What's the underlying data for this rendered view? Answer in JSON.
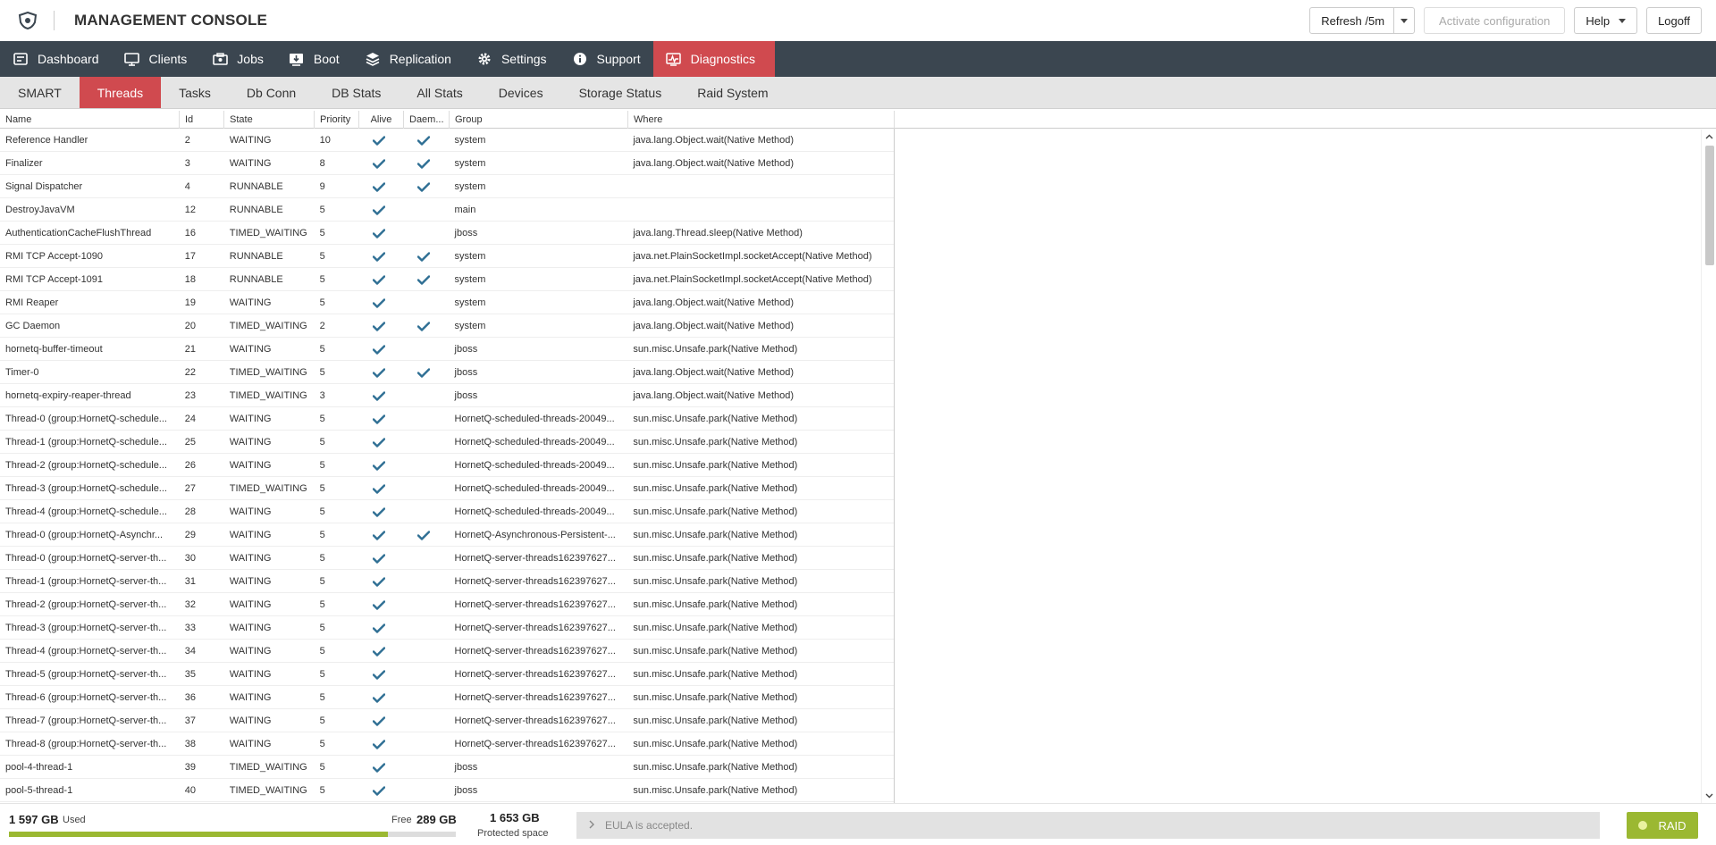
{
  "header": {
    "title": "MANAGEMENT CONSOLE",
    "refresh_label": "Refresh /5m",
    "activate_label": "Activate configuration",
    "help_label": "Help",
    "logoff_label": "Logoff"
  },
  "nav": {
    "items": [
      {
        "label": "Dashboard",
        "icon": "dashboard-icon"
      },
      {
        "label": "Clients",
        "icon": "monitor-icon"
      },
      {
        "label": "Jobs",
        "icon": "jobs-icon"
      },
      {
        "label": "Boot",
        "icon": "boot-icon"
      },
      {
        "label": "Replication",
        "icon": "replication-icon"
      },
      {
        "label": "Settings",
        "icon": "gear-icon"
      },
      {
        "label": "Support",
        "icon": "info-icon"
      },
      {
        "label": "Diagnostics",
        "icon": "diagnostics-icon"
      }
    ],
    "active": "Diagnostics"
  },
  "subnav": {
    "items": [
      "SMART",
      "Threads",
      "Tasks",
      "Db Conn",
      "DB Stats",
      "All Stats",
      "Devices",
      "Storage Status",
      "Raid System"
    ],
    "active": "Threads"
  },
  "table": {
    "columns": [
      "Name",
      "Id",
      "State",
      "Priority",
      "Alive",
      "Daem...",
      "Group",
      "Where"
    ],
    "rows": [
      {
        "name": "Reference Handler",
        "id": "2",
        "state": "WAITING",
        "priority": "10",
        "alive": true,
        "daemon": true,
        "group": "system",
        "where": "java.lang.Object.wait(Native Method)"
      },
      {
        "name": "Finalizer",
        "id": "3",
        "state": "WAITING",
        "priority": "8",
        "alive": true,
        "daemon": true,
        "group": "system",
        "where": "java.lang.Object.wait(Native Method)"
      },
      {
        "name": "Signal Dispatcher",
        "id": "4",
        "state": "RUNNABLE",
        "priority": "9",
        "alive": true,
        "daemon": true,
        "group": "system",
        "where": ""
      },
      {
        "name": "DestroyJavaVM",
        "id": "12",
        "state": "RUNNABLE",
        "priority": "5",
        "alive": true,
        "daemon": false,
        "group": "main",
        "where": ""
      },
      {
        "name": "AuthenticationCacheFlushThread",
        "id": "16",
        "state": "TIMED_WAITING",
        "priority": "5",
        "alive": true,
        "daemon": false,
        "group": "jboss",
        "where": "java.lang.Thread.sleep(Native Method)"
      },
      {
        "name": "RMI TCP Accept-1090",
        "id": "17",
        "state": "RUNNABLE",
        "priority": "5",
        "alive": true,
        "daemon": true,
        "group": "system",
        "where": "java.net.PlainSocketImpl.socketAccept(Native Method)"
      },
      {
        "name": "RMI TCP Accept-1091",
        "id": "18",
        "state": "RUNNABLE",
        "priority": "5",
        "alive": true,
        "daemon": true,
        "group": "system",
        "where": "java.net.PlainSocketImpl.socketAccept(Native Method)"
      },
      {
        "name": "RMI Reaper",
        "id": "19",
        "state": "WAITING",
        "priority": "5",
        "alive": true,
        "daemon": false,
        "group": "system",
        "where": "java.lang.Object.wait(Native Method)"
      },
      {
        "name": "GC Daemon",
        "id": "20",
        "state": "TIMED_WAITING",
        "priority": "2",
        "alive": true,
        "daemon": true,
        "group": "system",
        "where": "java.lang.Object.wait(Native Method)"
      },
      {
        "name": "hornetq-buffer-timeout",
        "id": "21",
        "state": "WAITING",
        "priority": "5",
        "alive": true,
        "daemon": false,
        "group": "jboss",
        "where": "sun.misc.Unsafe.park(Native Method)"
      },
      {
        "name": "Timer-0",
        "id": "22",
        "state": "TIMED_WAITING",
        "priority": "5",
        "alive": true,
        "daemon": true,
        "group": "jboss",
        "where": "java.lang.Object.wait(Native Method)"
      },
      {
        "name": "hornetq-expiry-reaper-thread",
        "id": "23",
        "state": "TIMED_WAITING",
        "priority": "3",
        "alive": true,
        "daemon": false,
        "group": "jboss",
        "where": "java.lang.Object.wait(Native Method)"
      },
      {
        "name": "Thread-0 (group:HornetQ-schedule...",
        "id": "24",
        "state": "WAITING",
        "priority": "5",
        "alive": true,
        "daemon": false,
        "group": "HornetQ-scheduled-threads-20049...",
        "where": "sun.misc.Unsafe.park(Native Method)"
      },
      {
        "name": "Thread-1 (group:HornetQ-schedule...",
        "id": "25",
        "state": "WAITING",
        "priority": "5",
        "alive": true,
        "daemon": false,
        "group": "HornetQ-scheduled-threads-20049...",
        "where": "sun.misc.Unsafe.park(Native Method)"
      },
      {
        "name": "Thread-2 (group:HornetQ-schedule...",
        "id": "26",
        "state": "WAITING",
        "priority": "5",
        "alive": true,
        "daemon": false,
        "group": "HornetQ-scheduled-threads-20049...",
        "where": "sun.misc.Unsafe.park(Native Method)"
      },
      {
        "name": "Thread-3 (group:HornetQ-schedule...",
        "id": "27",
        "state": "TIMED_WAITING",
        "priority": "5",
        "alive": true,
        "daemon": false,
        "group": "HornetQ-scheduled-threads-20049...",
        "where": "sun.misc.Unsafe.park(Native Method)"
      },
      {
        "name": "Thread-4 (group:HornetQ-schedule...",
        "id": "28",
        "state": "WAITING",
        "priority": "5",
        "alive": true,
        "daemon": false,
        "group": "HornetQ-scheduled-threads-20049...",
        "where": "sun.misc.Unsafe.park(Native Method)"
      },
      {
        "name": "Thread-0 (group:HornetQ-Asynchr...",
        "id": "29",
        "state": "WAITING",
        "priority": "5",
        "alive": true,
        "daemon": true,
        "group": "HornetQ-Asynchronous-Persistent-...",
        "where": "sun.misc.Unsafe.park(Native Method)"
      },
      {
        "name": "Thread-0 (group:HornetQ-server-th...",
        "id": "30",
        "state": "WAITING",
        "priority": "5",
        "alive": true,
        "daemon": false,
        "group": "HornetQ-server-threads162397627...",
        "where": "sun.misc.Unsafe.park(Native Method)"
      },
      {
        "name": "Thread-1 (group:HornetQ-server-th...",
        "id": "31",
        "state": "WAITING",
        "priority": "5",
        "alive": true,
        "daemon": false,
        "group": "HornetQ-server-threads162397627...",
        "where": "sun.misc.Unsafe.park(Native Method)"
      },
      {
        "name": "Thread-2 (group:HornetQ-server-th...",
        "id": "32",
        "state": "WAITING",
        "priority": "5",
        "alive": true,
        "daemon": false,
        "group": "HornetQ-server-threads162397627...",
        "where": "sun.misc.Unsafe.park(Native Method)"
      },
      {
        "name": "Thread-3 (group:HornetQ-server-th...",
        "id": "33",
        "state": "WAITING",
        "priority": "5",
        "alive": true,
        "daemon": false,
        "group": "HornetQ-server-threads162397627...",
        "where": "sun.misc.Unsafe.park(Native Method)"
      },
      {
        "name": "Thread-4 (group:HornetQ-server-th...",
        "id": "34",
        "state": "WAITING",
        "priority": "5",
        "alive": true,
        "daemon": false,
        "group": "HornetQ-server-threads162397627...",
        "where": "sun.misc.Unsafe.park(Native Method)"
      },
      {
        "name": "Thread-5 (group:HornetQ-server-th...",
        "id": "35",
        "state": "WAITING",
        "priority": "5",
        "alive": true,
        "daemon": false,
        "group": "HornetQ-server-threads162397627...",
        "where": "sun.misc.Unsafe.park(Native Method)"
      },
      {
        "name": "Thread-6 (group:HornetQ-server-th...",
        "id": "36",
        "state": "WAITING",
        "priority": "5",
        "alive": true,
        "daemon": false,
        "group": "HornetQ-server-threads162397627...",
        "where": "sun.misc.Unsafe.park(Native Method)"
      },
      {
        "name": "Thread-7 (group:HornetQ-server-th...",
        "id": "37",
        "state": "WAITING",
        "priority": "5",
        "alive": true,
        "daemon": false,
        "group": "HornetQ-server-threads162397627...",
        "where": "sun.misc.Unsafe.park(Native Method)"
      },
      {
        "name": "Thread-8 (group:HornetQ-server-th...",
        "id": "38",
        "state": "WAITING",
        "priority": "5",
        "alive": true,
        "daemon": false,
        "group": "HornetQ-server-threads162397627...",
        "where": "sun.misc.Unsafe.park(Native Method)"
      },
      {
        "name": "pool-4-thread-1",
        "id": "39",
        "state": "TIMED_WAITING",
        "priority": "5",
        "alive": true,
        "daemon": false,
        "group": "jboss",
        "where": "sun.misc.Unsafe.park(Native Method)"
      },
      {
        "name": "pool-5-thread-1",
        "id": "40",
        "state": "TIMED_WAITING",
        "priority": "5",
        "alive": true,
        "daemon": false,
        "group": "jboss",
        "where": "sun.misc.Unsafe.park(Native Method)"
      }
    ]
  },
  "footer": {
    "used_value": "1 597 GB",
    "used_label": "Used",
    "free_label": "Free",
    "free_value": "289 GB",
    "used_fraction": 0.847,
    "protected_value": "1 653 GB",
    "protected_label": "Protected space",
    "eula_text": "EULA is accepted.",
    "raid_label": "RAID"
  },
  "colors": {
    "accent": "#d04a4f",
    "nav_bg": "#3b4650",
    "check": "#2f6f94",
    "ok_green": "#9bb832"
  }
}
